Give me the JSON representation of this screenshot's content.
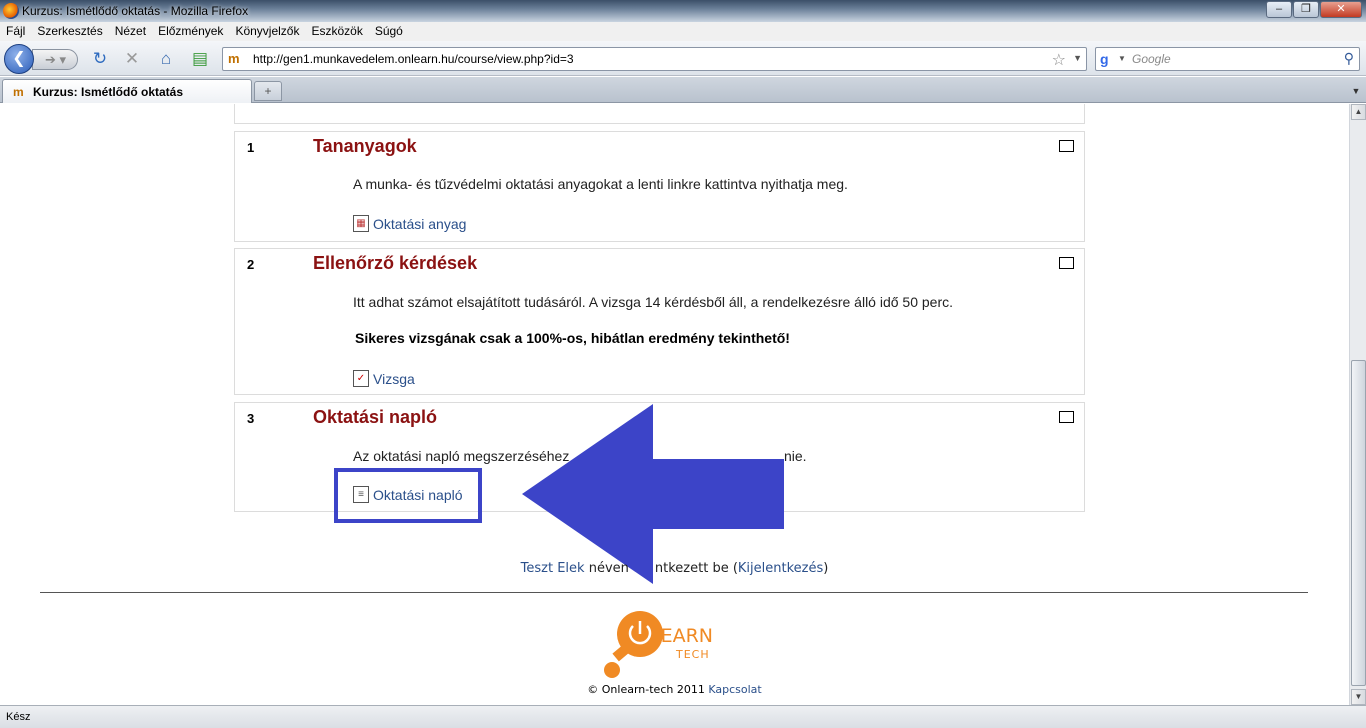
{
  "window": {
    "title": "Kurzus: Ismétlődő oktatás - Mozilla Firefox",
    "min": "–",
    "max": "❐",
    "close": "✕"
  },
  "menu": [
    "Fájl",
    "Szerkesztés",
    "Nézet",
    "Előzmények",
    "Könyvjelzők",
    "Eszközök",
    "Súgó"
  ],
  "nav": {
    "url": "http://gen1.munkavedelem.onlearn.hu/course/view.php?id=3",
    "search_placeholder": "Google"
  },
  "tabs": [
    {
      "label": "Kurzus: Ismétlődő oktatás"
    }
  ],
  "sections": [
    {
      "number": "1",
      "title": "Tananyagok",
      "texts": [
        "A munka- és tűzvédelmi oktatási anyagokat a lenti linkre kattintva nyithatja meg."
      ],
      "link": "Oktatási anyag"
    },
    {
      "number": "2",
      "title": "Ellenőrző kérdések",
      "texts": [
        "Itt adhat számot elsajátított tudásáról. A vizsga 14 kérdésből áll, a rendelkezésre álló idő 50 perc."
      ],
      "bold_text": "Sikeres vizsgának csak a 100%-os, hibátlan eredmény tekinthető!",
      "link": "Vizsga"
    },
    {
      "number": "3",
      "title": "Oktatási napló",
      "texts_left": "Az oktatási napló megszerzéséhez",
      "texts_right": "nie.",
      "link": "Oktatási napló"
    }
  ],
  "footer": {
    "user_link": "Teszt Elek",
    "login_mid_a": " néven",
    "login_mid_b": "ntkezett be (",
    "logout_link": "Kijelentkezés",
    "login_end": ")",
    "logo_on": "ON",
    "logo_learn": "LEARN",
    "logo_tech": "TECH",
    "copyright": "© Onlearn-tech 2011 ",
    "contact_link": "Kapcsolat"
  },
  "status": "Kész",
  "colors": {
    "section_title": "#8b1212",
    "link": "#2a4f8a",
    "annotation": "#3c44c8",
    "logo_orange": "#f08a24"
  }
}
